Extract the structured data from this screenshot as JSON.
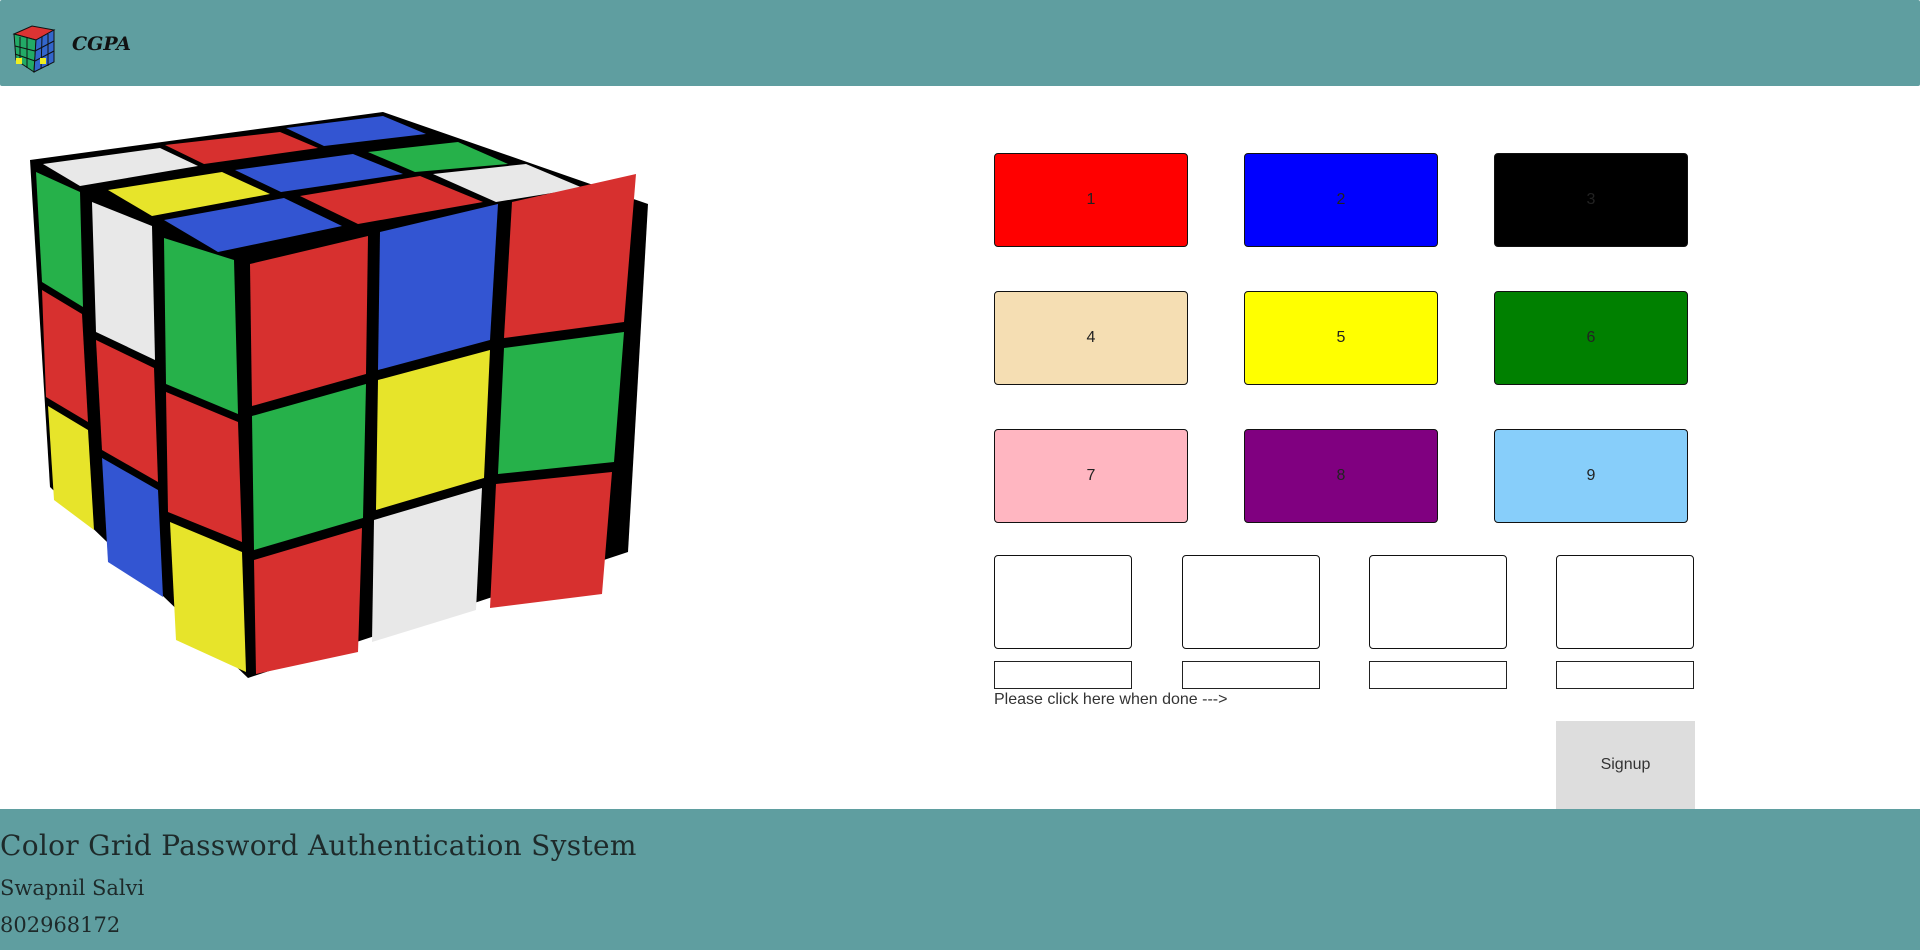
{
  "header": {
    "logo_text": "CGPA",
    "logo_icon": "rubiks-cube-icon",
    "background": "#5f9ea0"
  },
  "hero": {
    "image": "rubiks-cube-illustration"
  },
  "color_buttons": [
    {
      "label": "1",
      "color": "#ff0000"
    },
    {
      "label": "2",
      "color": "#0000ff"
    },
    {
      "label": "3",
      "color": "#000000"
    },
    {
      "label": "4",
      "color": "#f5deb3"
    },
    {
      "label": "5",
      "color": "#ffff00"
    },
    {
      "label": "6",
      "color": "#008000"
    },
    {
      "label": "7",
      "color": "#ffb6c1"
    },
    {
      "label": "8",
      "color": "#800080"
    },
    {
      "label": "9",
      "color": "#87cefa"
    }
  ],
  "slots": [
    {
      "value": ""
    },
    {
      "value": ""
    },
    {
      "value": ""
    },
    {
      "value": ""
    }
  ],
  "form": {
    "hint": "Please click here when done --->",
    "signup_label": "Signup"
  },
  "footer": {
    "title": "Color Grid Password Authentication System",
    "author": "Swapnil Salvi",
    "phone": "802968172"
  }
}
